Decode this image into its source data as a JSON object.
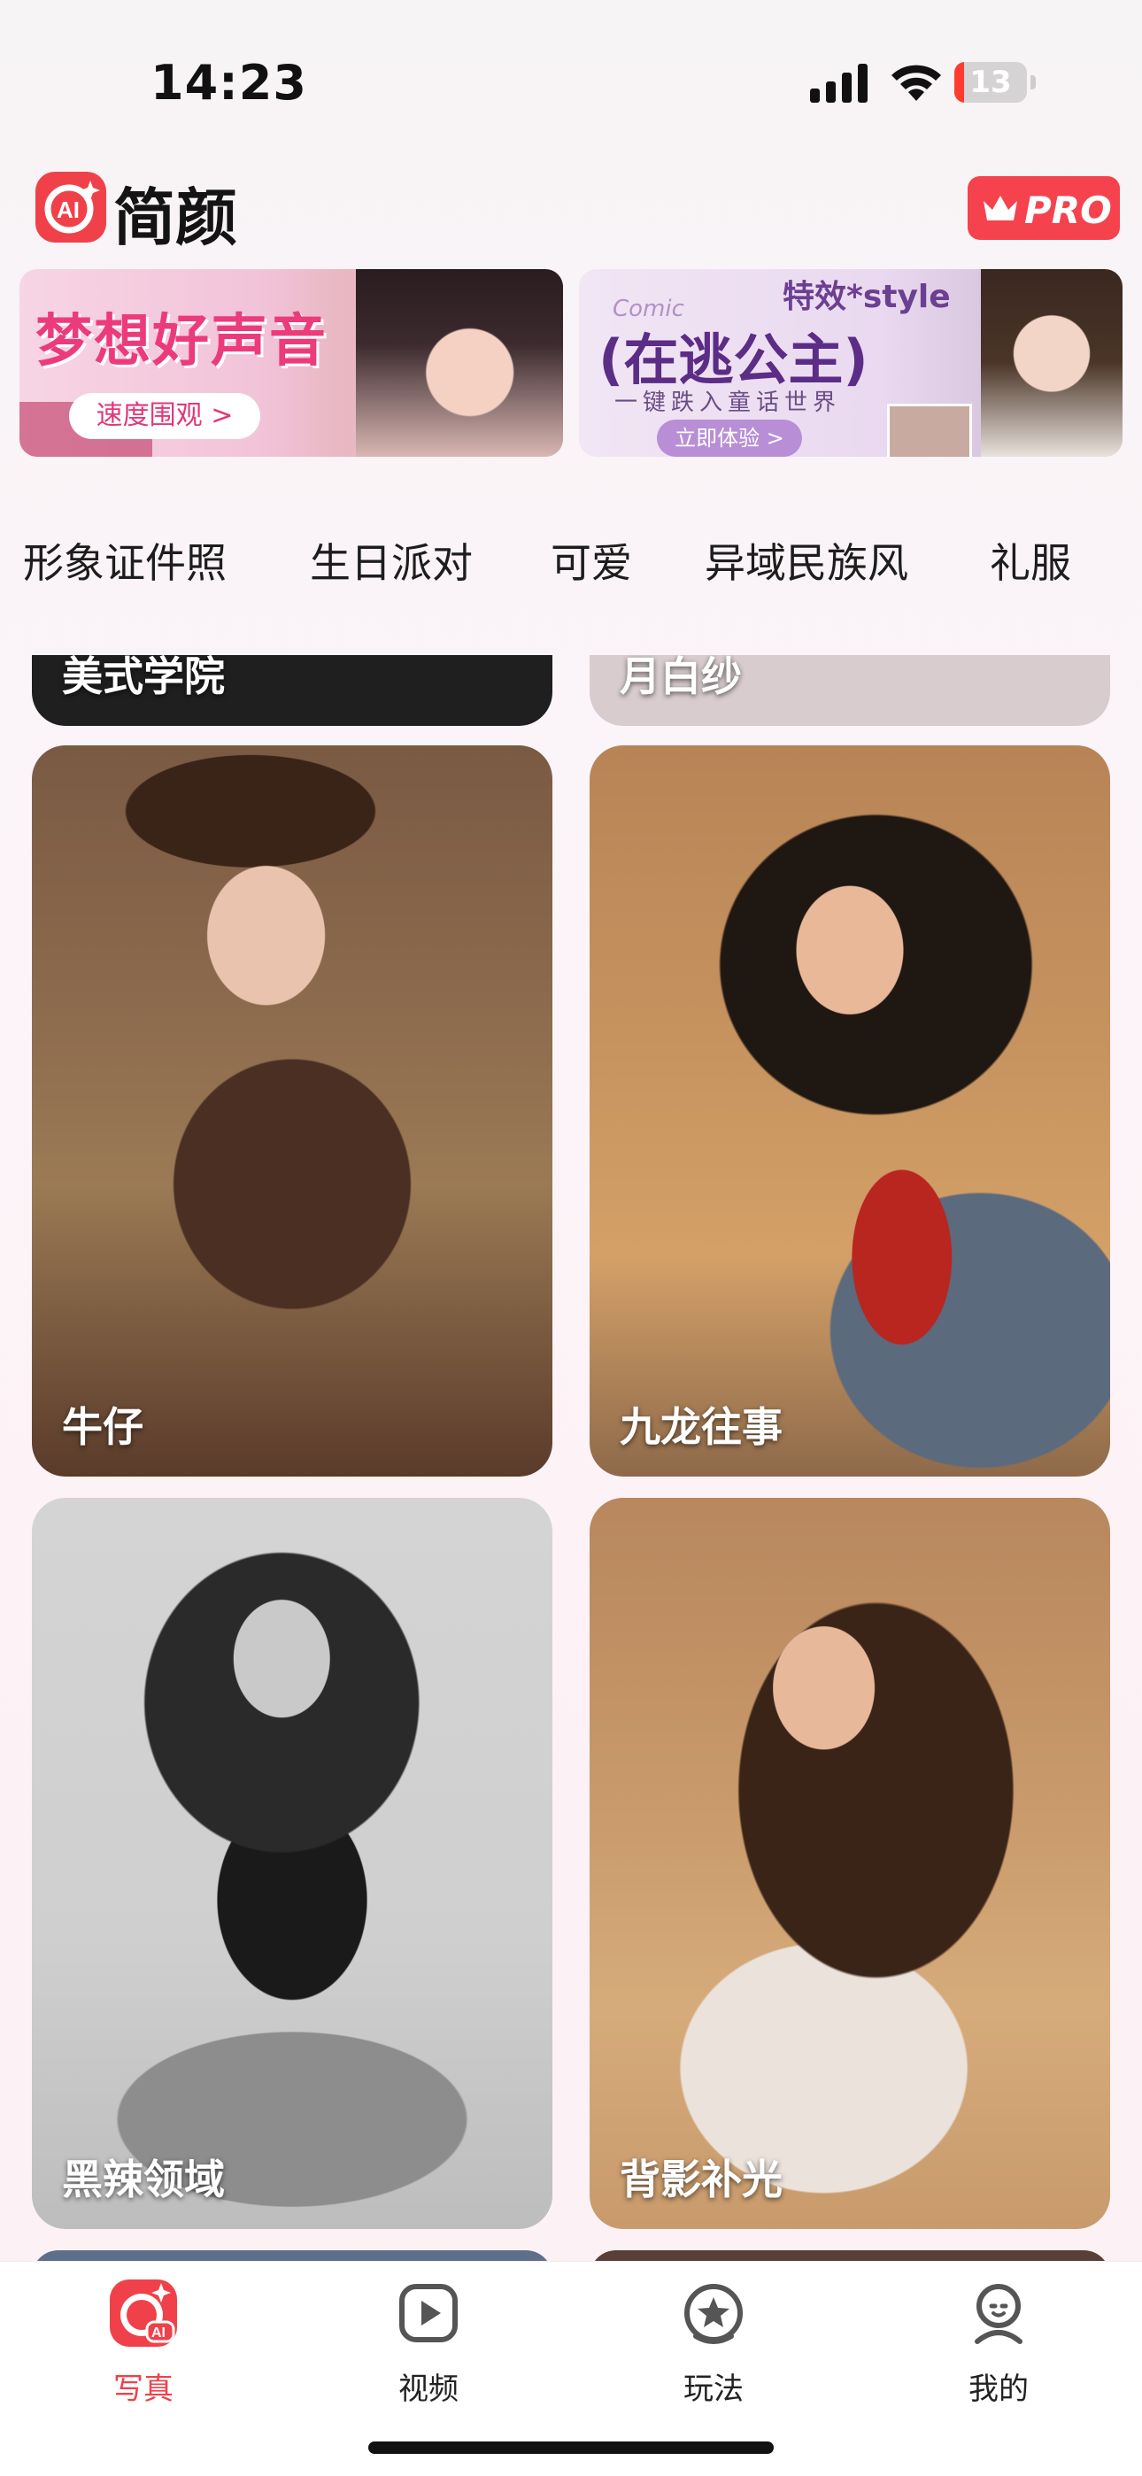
{
  "status_bar": {
    "time": "14:23",
    "battery": "13",
    "battery_level": 0.13
  },
  "header": {
    "app_name": "简颜",
    "logo_text": "AI",
    "pro_label": "PRO"
  },
  "banners": [
    {
      "title": "梦想好声音",
      "button": "速度围观 >"
    },
    {
      "tag": "特效*style",
      "comic": "Comic",
      "title": "(在逃公主)",
      "subtitle": "一键跌入童话世界",
      "button": "立即体验 >"
    }
  ],
  "categories": [
    "形象证件照",
    "生日派对",
    "可爱",
    "异域民族风",
    "礼服"
  ],
  "grid": {
    "partial_top": [
      "美式学院",
      "月白纱"
    ],
    "cards": [
      {
        "label": "牛仔"
      },
      {
        "label": "九龙往事"
      },
      {
        "label": "黑辣领域"
      },
      {
        "label": "背影补光"
      }
    ]
  },
  "tabbar": {
    "items": [
      {
        "label": "写真",
        "icon": "ai-camera-icon",
        "active": true
      },
      {
        "label": "视频",
        "icon": "play-icon",
        "active": false
      },
      {
        "label": "玩法",
        "icon": "star-icon",
        "active": false
      },
      {
        "label": "我的",
        "icon": "profile-icon",
        "active": false
      }
    ]
  },
  "colors": {
    "accent": "#f0414a",
    "text": "#1d1d1d",
    "background": "#fbf4f8"
  }
}
